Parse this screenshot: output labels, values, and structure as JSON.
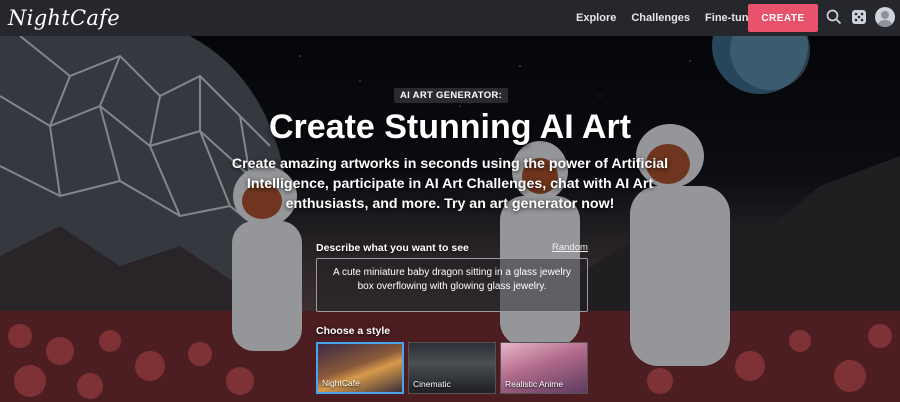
{
  "header": {
    "logo": "NightCafe",
    "nav": [
      "Explore",
      "Challenges",
      "Fine-tuning"
    ],
    "create_label": "CREATE",
    "icons": [
      "search-icon",
      "dice-icon",
      "avatar-icon"
    ],
    "accent_color": "#e8526b"
  },
  "hero": {
    "badge": "AI ART GENERATOR:",
    "title": "Create Stunning AI Art",
    "subtitle": "Create amazing artworks in seconds using the power of Artificial Intelligence, participate in AI Art Challenges, chat with AI Art enthusiasts, and more. Try an art generator now!"
  },
  "prompt": {
    "label": "Describe what you want to see",
    "random_label": "Random",
    "value": "A cute miniature baby dragon sitting in a glass jewelry box overflowing with glowing glass jewelry."
  },
  "styles": {
    "label": "Choose a style",
    "items": [
      {
        "name": "NightCafe",
        "selected": true
      },
      {
        "name": "Cinematic",
        "selected": false
      },
      {
        "name": "Realistic Anime",
        "selected": false
      }
    ],
    "selected_color": "#4aa3f0"
  }
}
